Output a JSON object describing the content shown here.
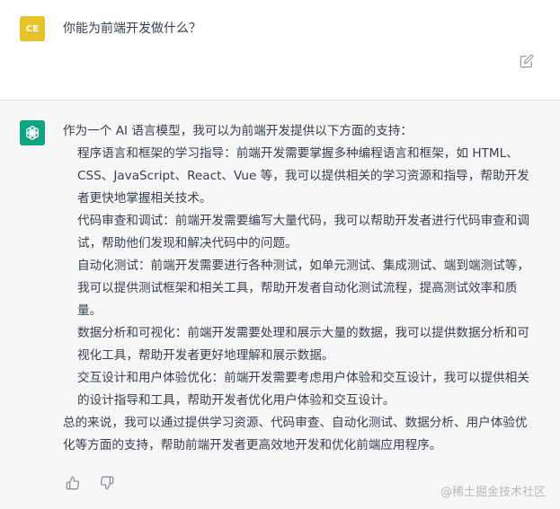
{
  "user": {
    "avatar_initials": "CE",
    "message": "你能为前端开发做什么？"
  },
  "assistant": {
    "intro": "作为一个 AI 语言模型，我可以为前端开发提供以下方面的支持：",
    "items": [
      "程序语言和框架的学习指导：前端开发需要掌握多种编程语言和框架，如 HTML、CSS、JavaScript、React、Vue 等，我可以提供相关的学习资源和指导，帮助开发者更快地掌握相关技术。",
      "代码审查和调试：前端开发需要编写大量代码，我可以帮助开发者进行代码审查和调试，帮助他们发现和解决代码中的问题。",
      "自动化测试：前端开发需要进行各种测试，如单元测试、集成测试、端到端测试等，我可以提供测试框架和相关工具，帮助开发者自动化测试流程，提高测试效率和质量。",
      "数据分析和可视化：前端开发需要处理和展示大量的数据，我可以提供数据分析和可视化工具，帮助开发者更好地理解和展示数据。",
      "交互设计和用户体验优化：前端开发需要考虑用户体验和交互设计，我可以提供相关的设计指导和工具，帮助开发者优化用户体验和交互设计。"
    ],
    "summary": "总的来说，我可以通过提供学习资源、代码审查、自动化测试、数据分析、用户体验优化等方面的支持，帮助前端开发者更高效地开发和优化前端应用程序。"
  },
  "watermark": "@稀土掘金技术社区",
  "icons": {
    "edit": "edit-icon",
    "thumbs_up": "thumbs-up-icon",
    "thumbs_down": "thumbs-down-icon",
    "bot": "openai-logo-icon"
  },
  "colors": {
    "user_avatar": "#e9c22a",
    "bot_avatar": "#10a37f",
    "assistant_bg": "#f7f7f8"
  }
}
